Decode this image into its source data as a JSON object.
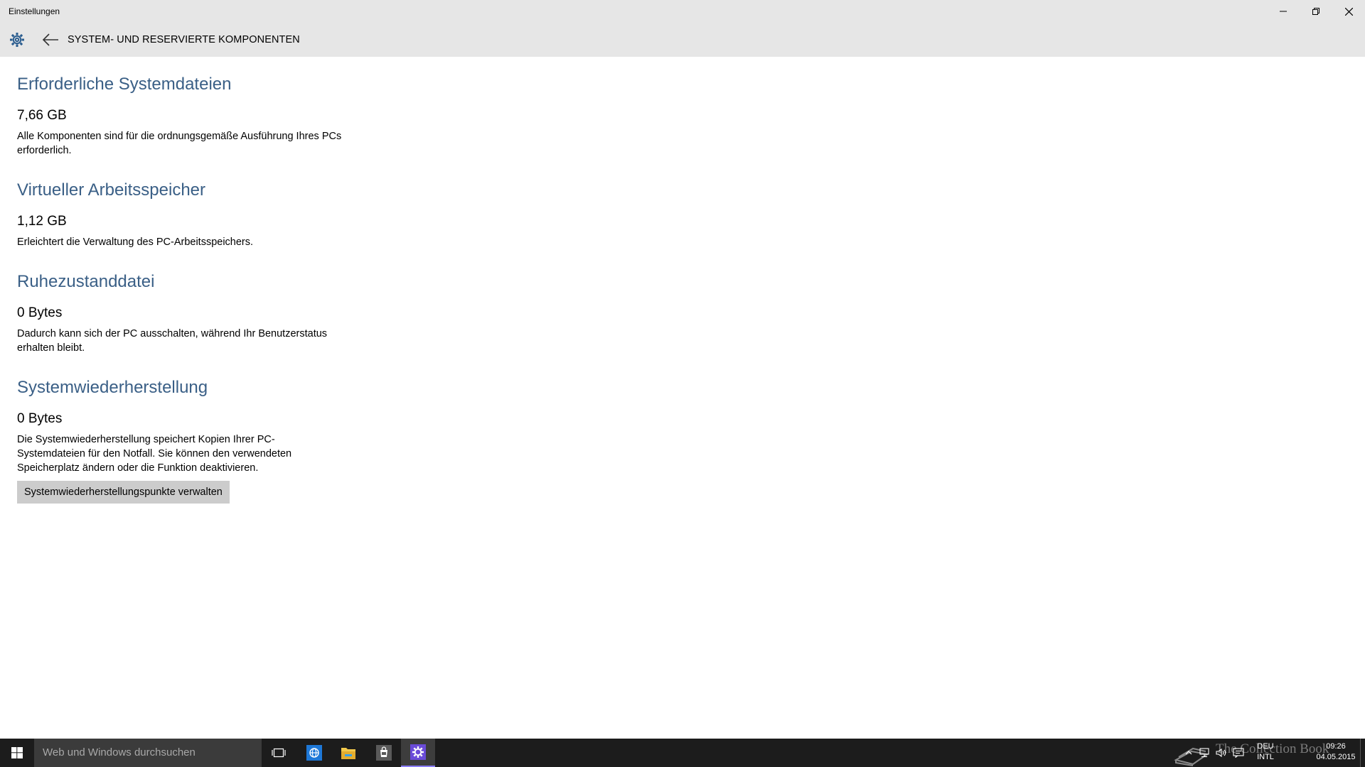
{
  "window": {
    "title": "Einstellungen",
    "controls": [
      "minimize",
      "restore",
      "close"
    ]
  },
  "header": {
    "settings_icon": "gear-icon",
    "back_icon": "back-arrow-icon",
    "title": "SYSTEM- UND RESERVIERTE KOMPONENTEN"
  },
  "sections": [
    {
      "heading": "Erforderliche Systemdateien",
      "size": "7,66 GB",
      "description": "Alle Komponenten sind für die ordnungsgemäße Ausführung Ihres PCs erforderlich."
    },
    {
      "heading": "Virtueller Arbeitsspeicher",
      "size": "1,12 GB",
      "description": "Erleichtert die Verwaltung des PC-Arbeitsspeichers."
    },
    {
      "heading": "Ruhezustanddatei",
      "size": "0 Bytes",
      "description": "Dadurch kann sich der PC ausschalten, während Ihr Benutzerstatus erhalten bleibt."
    },
    {
      "heading": "Systemwiederherstellung",
      "size": "0 Bytes",
      "description": "Die Systemwiederherstellung speichert Kopien Ihrer PC-Systemdateien für den Notfall. Sie können den verwendeten Speicherplatz ändern oder die Funktion deaktivieren.",
      "button_label": "Systemwiederherstellungspunkte verwalten"
    }
  ],
  "taskbar": {
    "search_placeholder": "Web und Windows durchsuchen",
    "pinned": [
      "task-view-icon",
      "internet-explorer-icon",
      "file-explorer-icon",
      "store-icon",
      "settings-icon"
    ],
    "active_app": "settings-icon",
    "watermark": "The Collection Book",
    "language_top": "DEU",
    "language_bottom": "INTL",
    "time": "09:26",
    "date": "04.05.2015"
  },
  "colors": {
    "accent_heading": "#3a5f86",
    "chrome": "#e6e6e6",
    "taskbar": "#1c1c1c",
    "button": "#cccccc",
    "active_indicator": "#8a7dff"
  }
}
